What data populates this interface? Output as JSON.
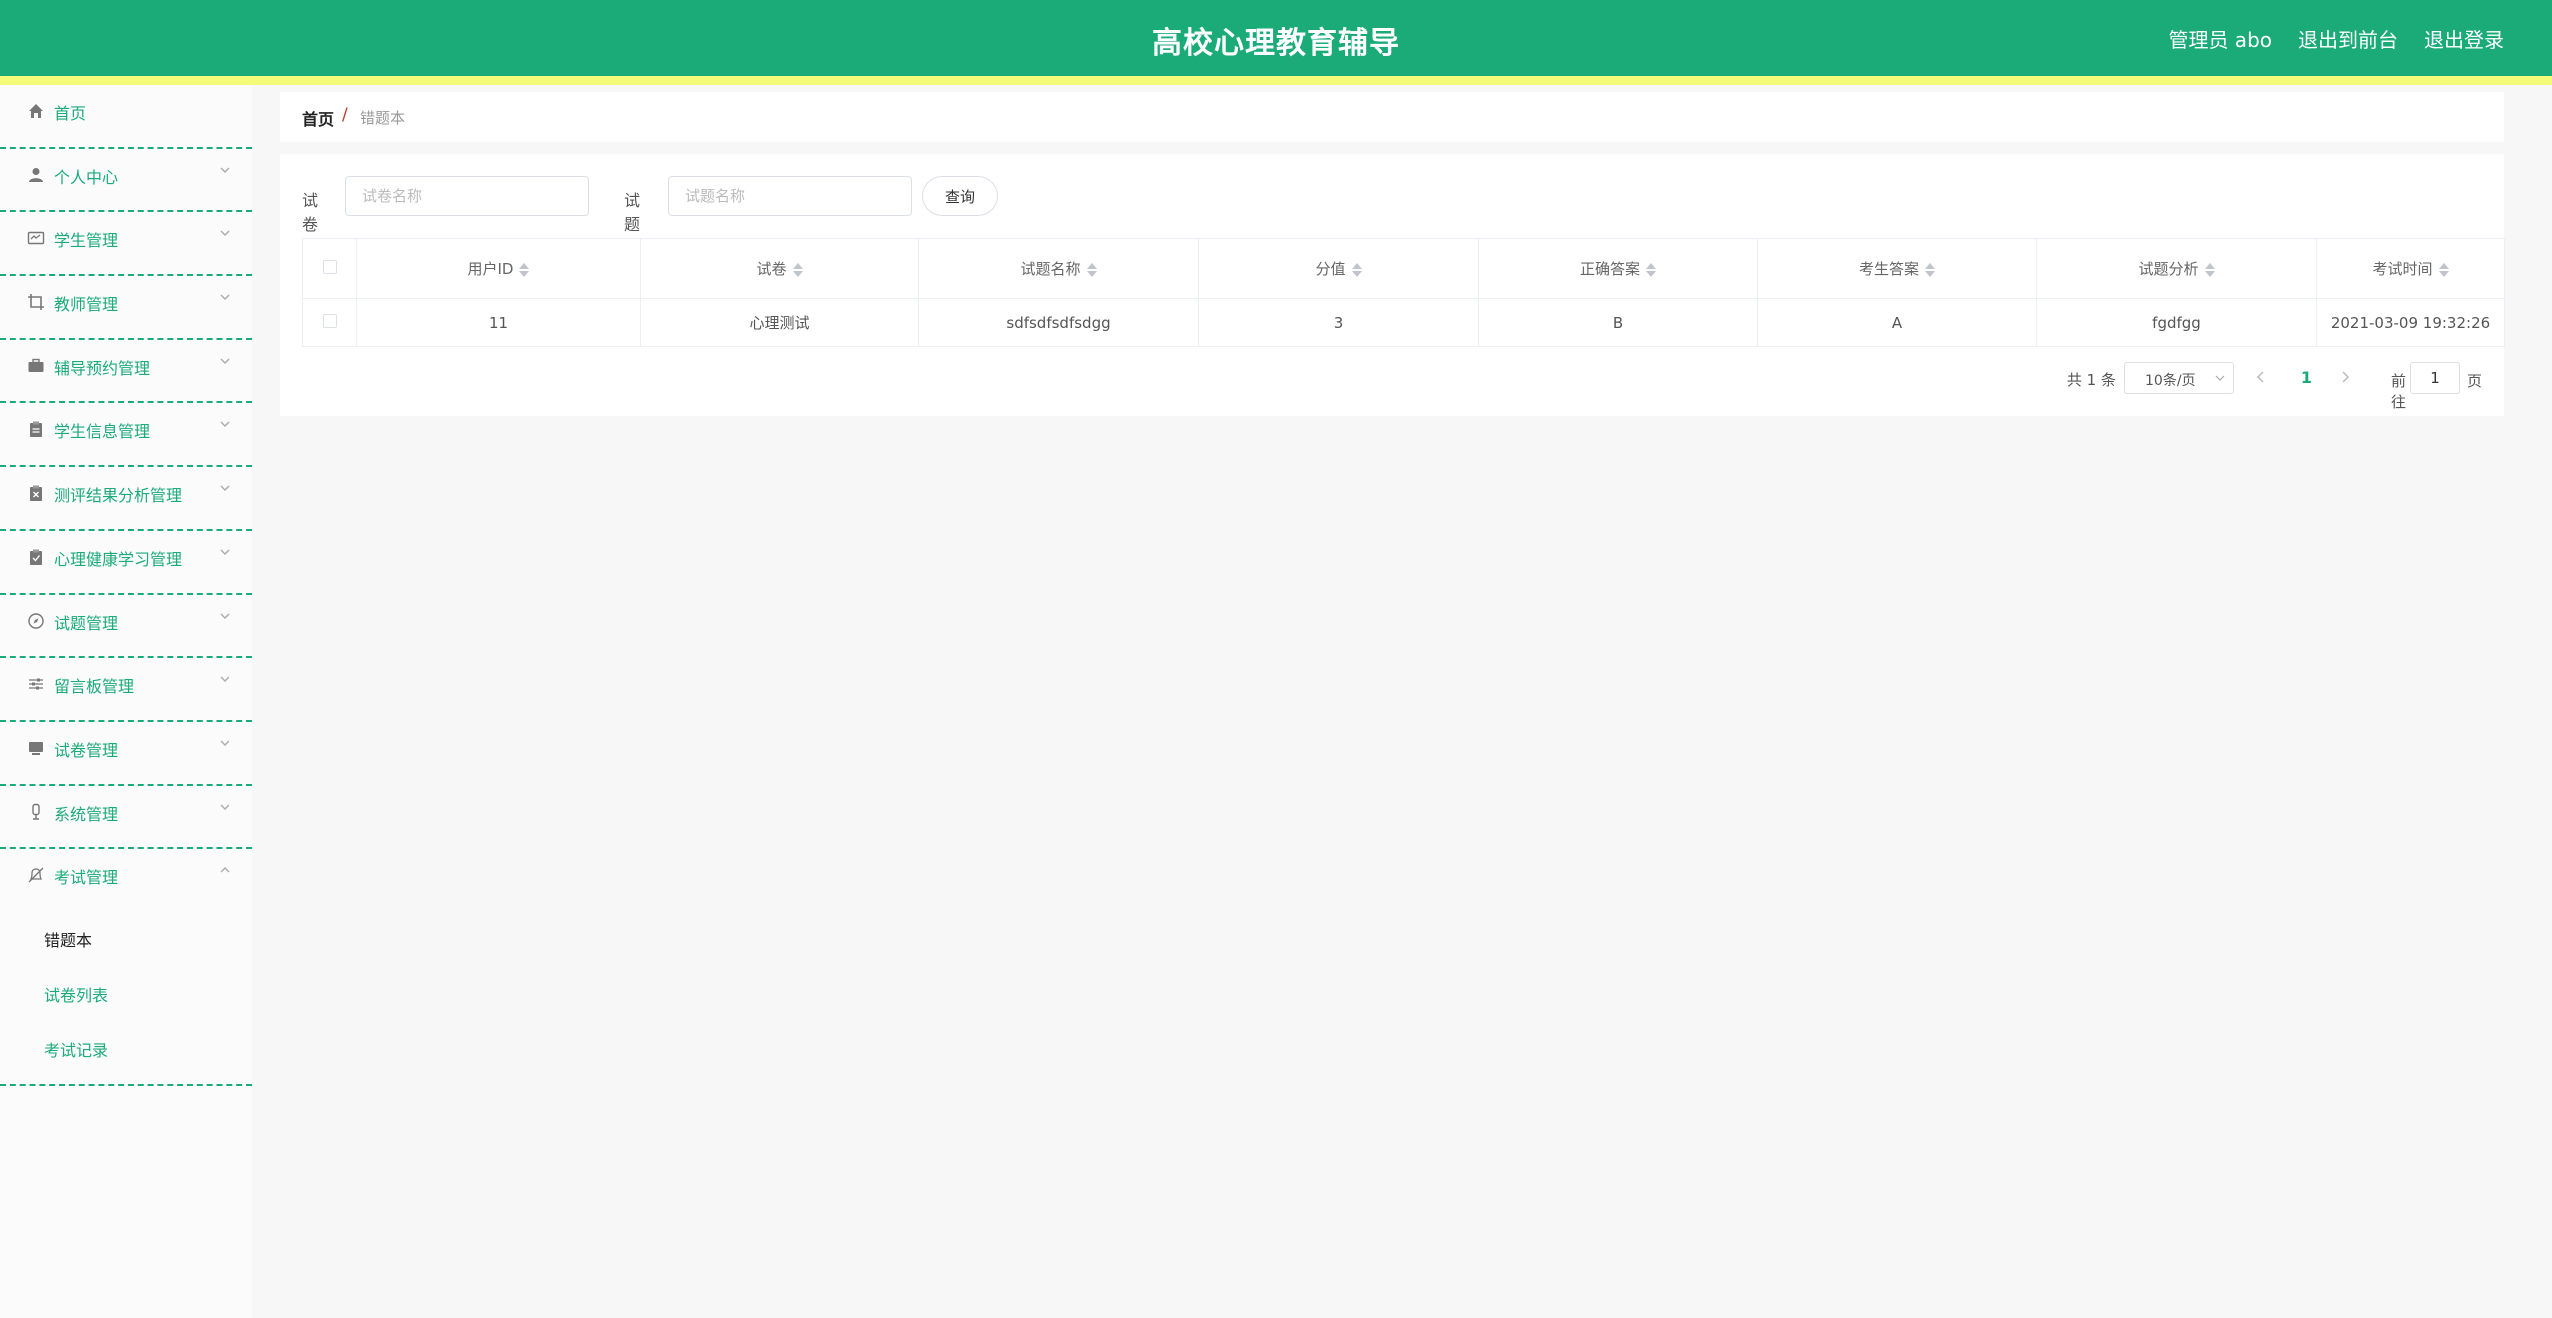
{
  "header": {
    "title": "高校心理教育辅导",
    "user_label": "管理员 abo",
    "front_label": "退出到前台",
    "logout_label": "退出登录"
  },
  "sidebar": {
    "items": [
      {
        "label": "首页",
        "icon": "home-icon"
      },
      {
        "label": "个人中心",
        "icon": "user-icon"
      },
      {
        "label": "学生管理",
        "icon": "id-card-icon"
      },
      {
        "label": "教师管理",
        "icon": "crop-icon"
      },
      {
        "label": "辅导预约管理",
        "icon": "briefcase-icon"
      },
      {
        "label": "学生信息管理",
        "icon": "clipboard-icon"
      },
      {
        "label": "测评结果分析管理",
        "icon": "clipboard-x-icon"
      },
      {
        "label": "心理健康学习管理",
        "icon": "clipboard-check-icon"
      },
      {
        "label": "试题管理",
        "icon": "compass-icon"
      },
      {
        "label": "留言板管理",
        "icon": "sliders-icon"
      },
      {
        "label": "试卷管理",
        "icon": "monitor-icon"
      },
      {
        "label": "系统管理",
        "icon": "microphone-icon"
      },
      {
        "label": "考试管理",
        "icon": "bell-off-icon"
      }
    ],
    "exam_submenu": [
      "错题本",
      "试卷列表",
      "考试记录"
    ]
  },
  "breadcrumb": {
    "home": "首页",
    "separator": "/",
    "current": "错题本"
  },
  "search": {
    "paper_label": "试卷",
    "paper_placeholder": "试卷名称",
    "question_label": "试题",
    "question_placeholder": "试题名称",
    "button_label": "查询"
  },
  "table": {
    "columns": [
      "用户ID",
      "试卷",
      "试题名称",
      "分值",
      "正确答案",
      "考生答案",
      "试题分析",
      "考试时间"
    ],
    "rows": [
      [
        "11",
        "心理测试",
        "sdfsdfsdfsdgg",
        "3",
        "B",
        "A",
        "fgdfgg",
        "2021-03-09 19:32:26"
      ]
    ]
  },
  "pagination": {
    "total": "共 1 条",
    "page_size": "10条/页",
    "current_page": "1",
    "goto_label": "前往",
    "goto_value": "1",
    "page_unit": "页"
  },
  "colors": {
    "primary": "#1aab79",
    "stripe": "#f3fb78"
  }
}
